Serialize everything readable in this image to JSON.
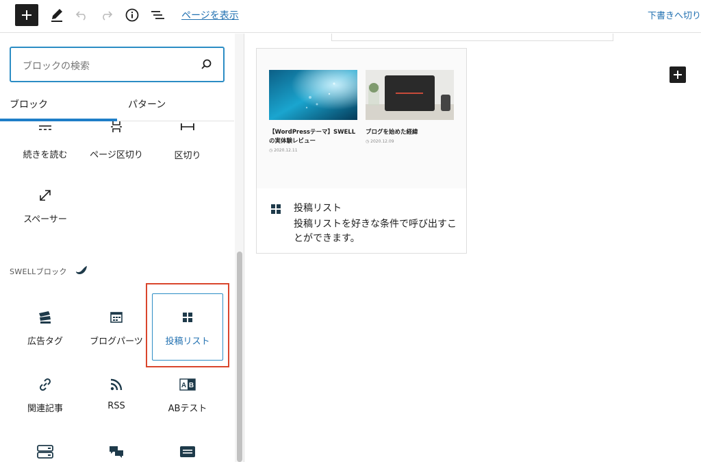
{
  "toolbar": {
    "view_page_label": "ページを表示",
    "save_draft_label": "下書きへ切り"
  },
  "sidebar": {
    "search_placeholder": "ブロックの検索",
    "tabs": [
      {
        "label": "ブロック",
        "active": true
      },
      {
        "label": "パターン",
        "active": false
      }
    ],
    "layout_blocks": [
      {
        "label": "続きを読む",
        "icon": "more-icon"
      },
      {
        "label": "ページ区切り",
        "icon": "page-break-icon"
      },
      {
        "label": "区切り",
        "icon": "separator-icon"
      },
      {
        "label": "スペーサー",
        "icon": "spacer-icon"
      }
    ],
    "section_title": "SWELLブロック",
    "swell_blocks": [
      {
        "label": "広告タグ",
        "icon": "ad-tag-icon"
      },
      {
        "label": "ブログパーツ",
        "icon": "blog-parts-icon"
      },
      {
        "label": "投稿リスト",
        "icon": "post-list-icon",
        "selected": true
      },
      {
        "label": "関連記事",
        "icon": "link-icon"
      },
      {
        "label": "RSS",
        "icon": "rss-icon"
      },
      {
        "label": "ABテスト",
        "icon": "ab-test-icon"
      },
      {
        "label": "",
        "icon": "server-icon"
      },
      {
        "label": "",
        "icon": "comments-icon"
      },
      {
        "label": "",
        "icon": "card-icon"
      }
    ]
  },
  "preview": {
    "posts": [
      {
        "title": "【WordPressテーマ】SWELLの実体験レビュー",
        "date": "2020.12.11"
      },
      {
        "title": "ブログを始めた経緯",
        "date": "2020.12.09"
      }
    ],
    "block_name": "投稿リスト",
    "block_description": "投稿リストを好きな条件で呼び出すことができます。"
  },
  "colors": {
    "accent": "#2b8cc4",
    "highlight": "#d9452b",
    "icon_dark": "#1e3a4a"
  }
}
